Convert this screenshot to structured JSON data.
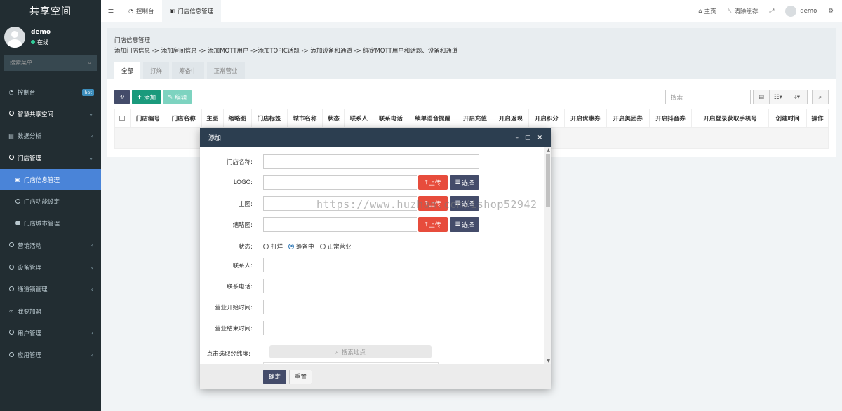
{
  "app": {
    "title": "共享空间"
  },
  "user": {
    "name": "demo",
    "status": "在线"
  },
  "sidebar": {
    "search_placeholder": "搜索菜单",
    "items": [
      {
        "label": "控制台",
        "icon": "dashboard-icon",
        "badge": "hot"
      },
      {
        "label": "智慧共享空间",
        "icon": "circle-icon"
      },
      {
        "label": "数据分析",
        "icon": "chart-icon"
      },
      {
        "label": "门店管理",
        "icon": "circle-icon"
      },
      {
        "label": "门店信息管理",
        "icon": "shop-icon"
      },
      {
        "label": "门店功能设定",
        "icon": "circle-icon"
      },
      {
        "label": "门店城市管理",
        "icon": "circle-icon"
      },
      {
        "label": "营销活动",
        "icon": "circle-icon"
      },
      {
        "label": "设备管理",
        "icon": "circle-icon"
      },
      {
        "label": "通道锁管理",
        "icon": "circle-icon"
      },
      {
        "label": "我要加盟",
        "icon": "handshake-icon"
      },
      {
        "label": "用户管理",
        "icon": "circle-icon"
      },
      {
        "label": "应用管理",
        "icon": "circle-icon"
      }
    ]
  },
  "topbar": {
    "tabs": [
      {
        "label": "控制台",
        "icon": "dashboard-icon"
      },
      {
        "label": "门店信息管理",
        "icon": "shop-icon"
      }
    ],
    "home": "主页",
    "clear_cache": "清除缓存",
    "user": "demo"
  },
  "panel": {
    "title": "门店信息管理",
    "description": "添加门店信息 -> 添加房间信息 -> 添加MQTT用户 ->添加TOPIC话题 -> 添加设备和通道 -> 绑定MQTT用户和话题、设备和通道",
    "tabs": [
      "全部",
      "打烊",
      "筹备中",
      "正常营业"
    ],
    "add_label": "添加",
    "edit_label": "编辑",
    "search_placeholder": "搜索",
    "columns": [
      "门店编号",
      "门店名称",
      "主图",
      "缩略图",
      "门店标签",
      "城市名称",
      "状态",
      "联系人",
      "联系电话",
      "续单语音提醒",
      "开启充值",
      "开启返现",
      "开启积分",
      "开启优惠券",
      "开启美团券",
      "开启抖音券",
      "开启登录获取手机号",
      "创建时间",
      "操作"
    ]
  },
  "dialog": {
    "title": "添加",
    "fields": {
      "name": "门店名称:",
      "logo": "LOGO:",
      "main_image": "主图:",
      "thumbnail": "缩略图:",
      "status": "状态:",
      "contact": "联系人:",
      "phone": "联系电话:",
      "open_time": "营业开始时间:",
      "close_time": "营业结束时间:",
      "location": "点击选取经纬度:"
    },
    "upload_label": "上传",
    "choose_label": "选择",
    "status_options": [
      "打烊",
      "筹备中",
      "正常营业"
    ],
    "status_selected": "筹备中",
    "map_search": "搜索地点",
    "ok_label": "确定",
    "reset_label": "重置"
  },
  "watermark": "https://www.huzhan.com/ishop52942"
}
